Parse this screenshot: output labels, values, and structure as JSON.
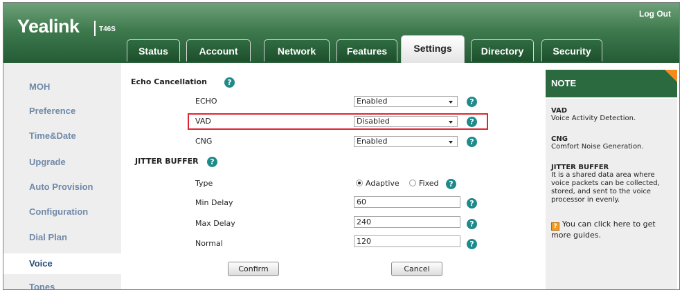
{
  "header": {
    "logo": "Yealink",
    "model": "T46S",
    "logout": "Log Out"
  },
  "tabs": [
    {
      "label": "Status"
    },
    {
      "label": "Account"
    },
    {
      "label": "Network"
    },
    {
      "label": "Features"
    },
    {
      "label": "Settings",
      "active": true
    },
    {
      "label": "Directory"
    },
    {
      "label": "Security"
    }
  ],
  "sidebar": {
    "items": [
      {
        "label": "MOH"
      },
      {
        "label": "Preference"
      },
      {
        "label": "Time&Date"
      },
      {
        "label": "Upgrade"
      },
      {
        "label": "Auto Provision"
      },
      {
        "label": "Configuration"
      },
      {
        "label": "Dial Plan"
      },
      {
        "label": "Voice",
        "active": true
      },
      {
        "label": "Tones"
      }
    ]
  },
  "form": {
    "echo_section": "Echo Cancellation",
    "echo_label": "ECHO",
    "echo_value": "Enabled",
    "vad_label": "VAD",
    "vad_value": "Disabled",
    "cng_label": "CNG",
    "cng_value": "Enabled",
    "jitter_section": "JITTER BUFFER",
    "type_label": "Type",
    "type_options": [
      "Adaptive",
      "Fixed"
    ],
    "type_selected": "Adaptive",
    "min_delay_label": "Min Delay",
    "min_delay_value": "60",
    "max_delay_label": "Max Delay",
    "max_delay_value": "240",
    "normal_label": "Normal",
    "normal_value": "120",
    "confirm": "Confirm",
    "cancel": "Cancel",
    "help_glyph": "?"
  },
  "note": {
    "title": "NOTE",
    "vad_title": "VAD",
    "vad_desc": "Voice Activity Detection.",
    "cng_title": "CNG",
    "cng_desc": "Comfort Noise Generation.",
    "jitter_title": "JITTER BUFFER",
    "jitter_desc": "It is a shared data area where voice packets can be collected, stored, and sent to the voice processor in evenly.",
    "guide_text": "You can click here to get more guides."
  },
  "colors": {
    "header_green": "#245b35",
    "highlight_red": "#e0242b",
    "help_teal": "#1f8a8a",
    "note_corner": "#f28c1e"
  }
}
